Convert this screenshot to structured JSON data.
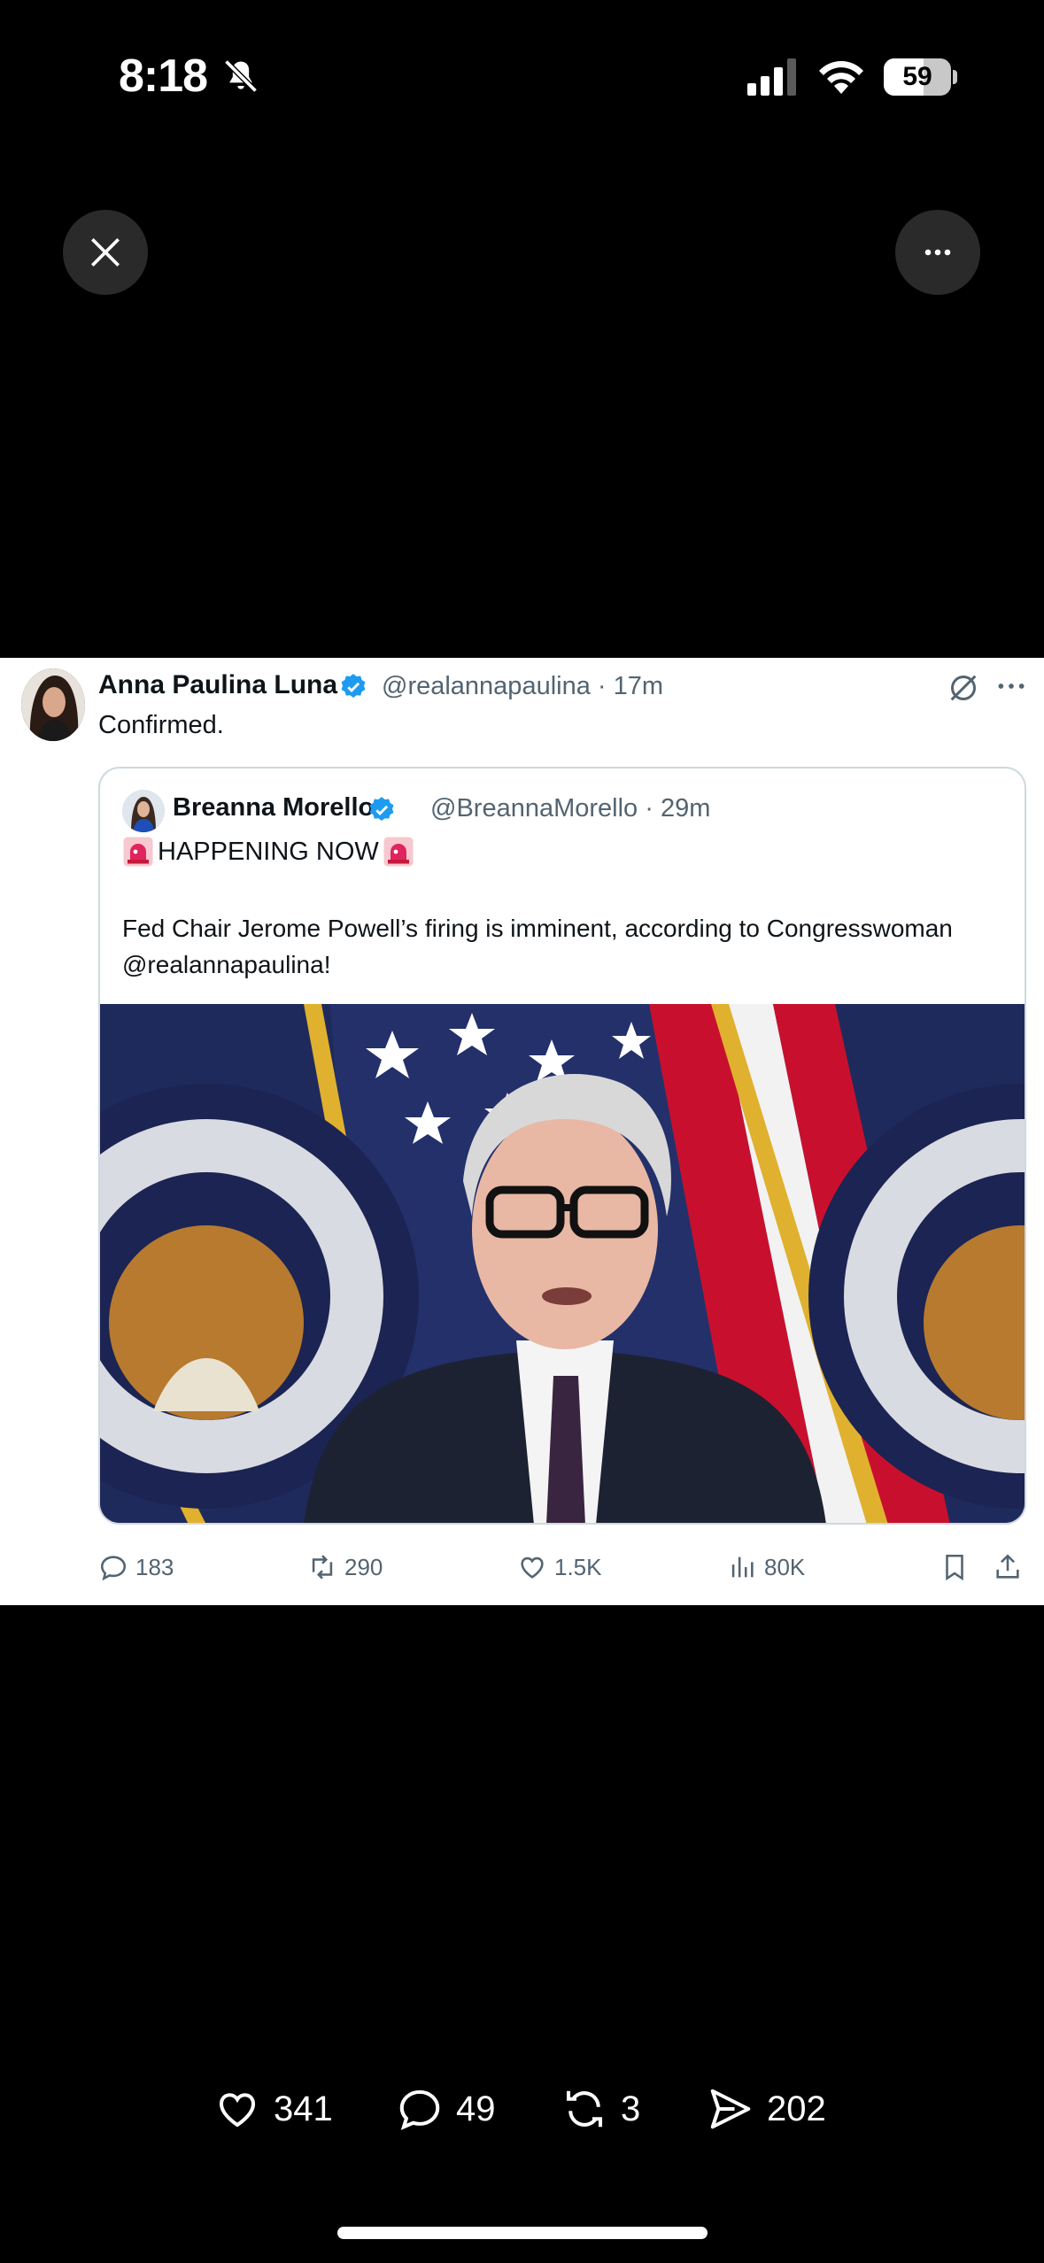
{
  "status_bar": {
    "time": "8:18",
    "battery_level": "59",
    "battery_fraction": 0.59
  },
  "tweet": {
    "author_name": "Anna Paulina Luna",
    "author_handle": "@realannapaulina · 17m",
    "text": "Confirmed.",
    "quote": {
      "author_name": "Breanna Morello",
      "author_handle": "@BreannaMorello · 29m",
      "headline": "HAPPENING NOW",
      "body": "Fed Chair Jerome Powell’s firing is imminent, according to Congresswoman @realannapaulina!"
    },
    "actions": {
      "replies": "183",
      "reposts": "290",
      "likes": "1.5K",
      "views": "80K"
    }
  },
  "bottom_bar": {
    "likes": "341",
    "comments": "49",
    "reposts": "3",
    "shares": "202"
  },
  "colors": {
    "background": "#000000",
    "card": "#ffffff",
    "verified": "#1d9bf0",
    "secondary_text": "#536471"
  },
  "icons": [
    "bell-slash-icon",
    "signal-icon",
    "wifi-icon",
    "close-icon",
    "more-icon",
    "verified-badge-icon",
    "grok-icon",
    "siren-icon",
    "reply-icon",
    "repost-icon",
    "heart-icon",
    "views-icon",
    "bookmark-icon",
    "share-icon",
    "comment-icon",
    "send-icon"
  ]
}
